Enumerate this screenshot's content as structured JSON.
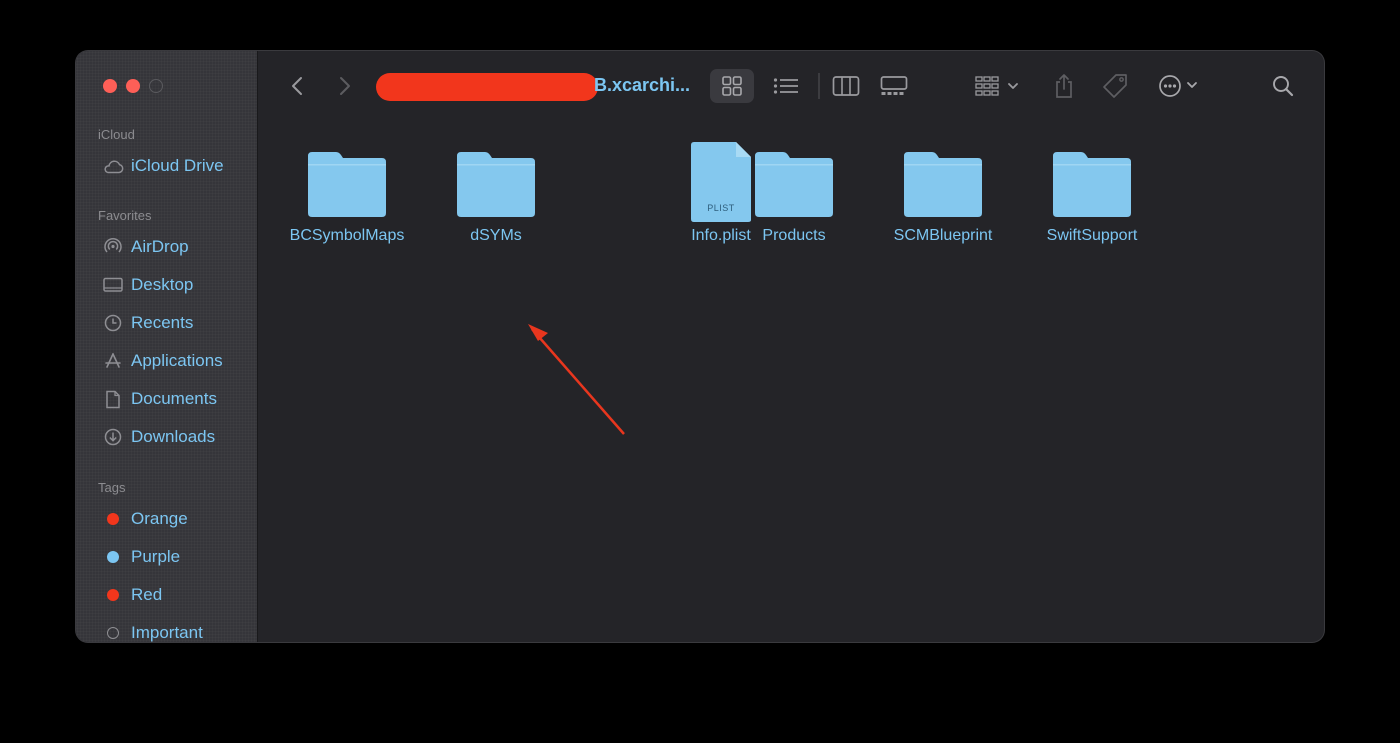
{
  "window": {
    "title": "B.xcarchi...",
    "toolbar": {
      "back": "chevron-left-icon",
      "forward": "chevron-right-icon",
      "views": [
        "grid-view-icon",
        "list-view-icon",
        "column-view-icon",
        "gallery-view-icon"
      ],
      "group": "group-by-icon",
      "share": "share-icon",
      "tags": "tag-icon",
      "more": "ellipsis-icon",
      "search": "search-icon"
    }
  },
  "sidebar": {
    "sections": [
      {
        "title": "iCloud",
        "items": [
          {
            "label": "iCloud Drive",
            "icon": "cloud-icon"
          }
        ]
      },
      {
        "title": "Favorites",
        "items": [
          {
            "label": "AirDrop",
            "icon": "airdrop-icon"
          },
          {
            "label": "Desktop",
            "icon": "desktop-icon"
          },
          {
            "label": "Recents",
            "icon": "clock-icon"
          },
          {
            "label": "Applications",
            "icon": "applications-icon"
          },
          {
            "label": "Documents",
            "icon": "document-icon"
          },
          {
            "label": "Downloads",
            "icon": "download-icon"
          }
        ]
      },
      {
        "title": "Tags",
        "items": [
          {
            "label": "Orange",
            "color": "#f2361c"
          },
          {
            "label": "Purple",
            "color": "#7cc6f2"
          },
          {
            "label": "Red",
            "color": "#f2361c"
          },
          {
            "label": "Important",
            "color": "none"
          }
        ]
      }
    ]
  },
  "files": [
    {
      "name": "BCSymbolMaps",
      "type": "folder"
    },
    {
      "name": "dSYMs",
      "type": "folder"
    },
    {
      "name": "Info.plist",
      "type": "plist",
      "badge": "PLIST"
    },
    {
      "name": "Products",
      "type": "folder"
    },
    {
      "name": "SCMBlueprint",
      "type": "folder"
    },
    {
      "name": "SwiftSupport",
      "type": "folder"
    }
  ],
  "colors": {
    "accent": "#7cc6f2",
    "folder": "#84c8ee",
    "annotation_arrow": "#e8361e",
    "redaction": "#f2361c"
  }
}
